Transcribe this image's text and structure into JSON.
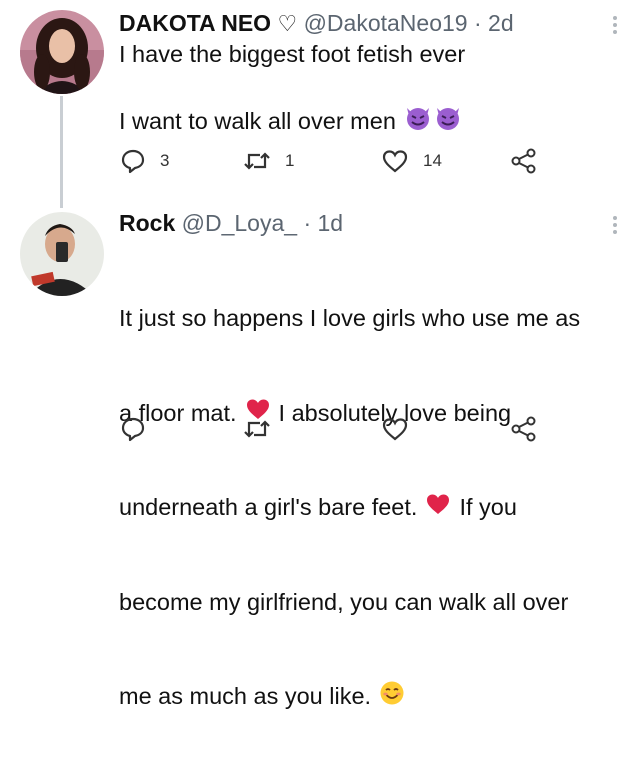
{
  "tweets": [
    {
      "name": "DAKOTA NEO",
      "name_badge": "♡",
      "handle": "@DakotaNeo19",
      "time": "2d",
      "lines": [
        "I have the biggest foot fetish ever",
        "",
        "I want to walk all over men"
      ],
      "emoji": [
        "devil-emoji",
        "devil-emoji"
      ],
      "actions": {
        "replies": "3",
        "retweets": "1",
        "likes": "14"
      }
    },
    {
      "name": "Rock",
      "handle": "@D_Loya_",
      "time": "1d",
      "lines": [
        "It just so happens I love girls who use me as",
        "a floor mat.",
        "I absolutely love being",
        "underneath a girl's bare feet.",
        "If you",
        "become my girlfriend, you can walk all over",
        "me as much as you like."
      ],
      "actions": {
        "replies": "",
        "retweets": "",
        "likes": ""
      }
    }
  ],
  "colors": {
    "heart": "#e0244a",
    "icon": "#333333",
    "thread_line": "#c9ced3",
    "muted": "#5b6570"
  }
}
